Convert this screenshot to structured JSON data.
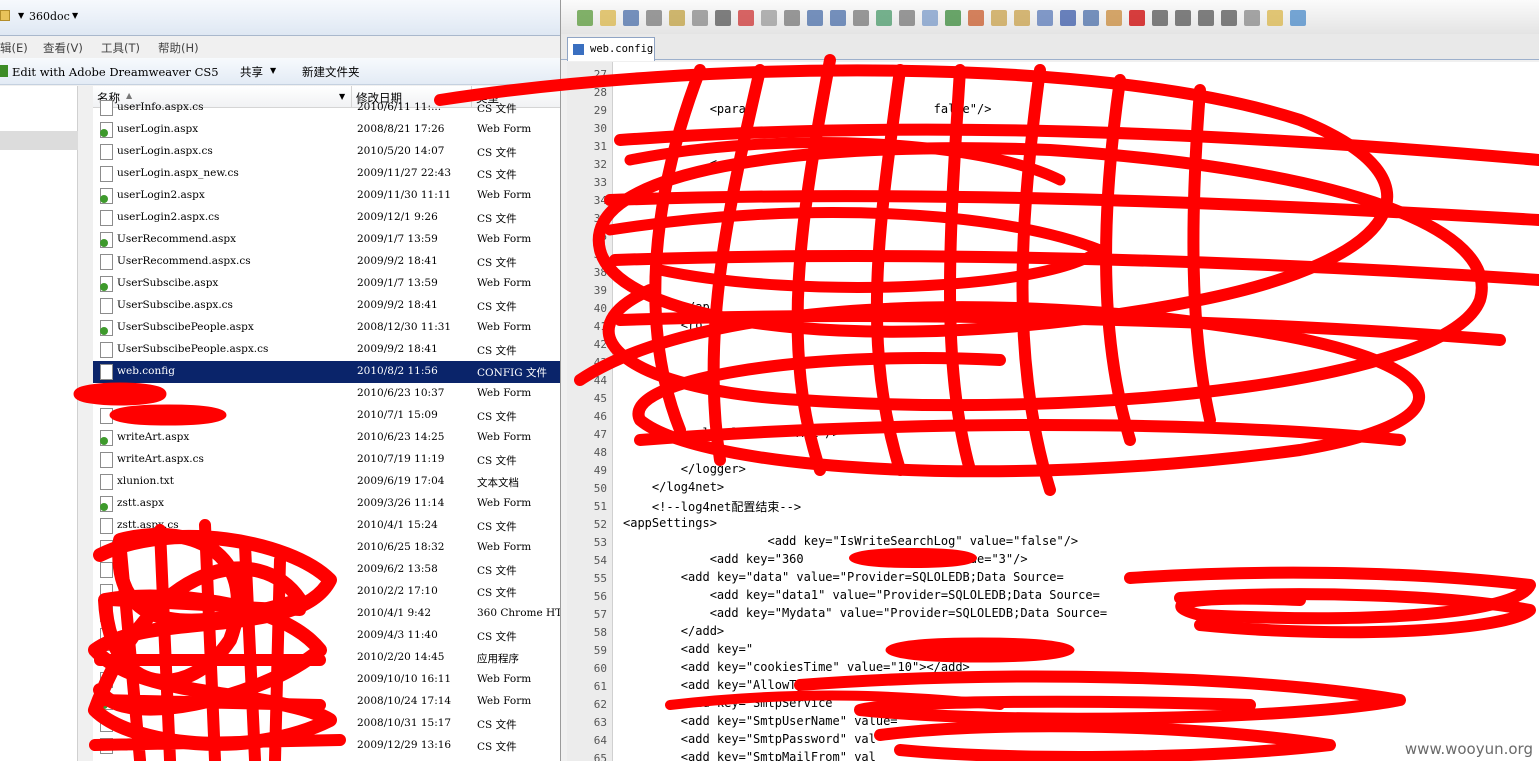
{
  "explorer": {
    "address": {
      "path": "360doc"
    },
    "menu": [
      "辑(E)",
      "查看(V)",
      "工具(T)",
      "帮助(H)"
    ],
    "commands": {
      "dreamweaver": "Edit with Adobe Dreamweaver CS5",
      "share": "共享",
      "new_folder": "新建文件夹"
    },
    "columns": {
      "name": "名称",
      "date": "修改日期",
      "type": "类型"
    },
    "files": [
      {
        "name": "userInfo.aspx.cs",
        "date": "2010/6/11 11:...",
        "type": "CS 文件",
        "icon": "cs"
      },
      {
        "name": "userLogin.aspx",
        "date": "2008/8/21 17:26",
        "type": "Web Form",
        "icon": "aspx"
      },
      {
        "name": "userLogin.aspx.cs",
        "date": "2010/5/20 14:07",
        "type": "CS 文件",
        "icon": "cs"
      },
      {
        "name": "userLogin.aspx_new.cs",
        "date": "2009/11/27 22:43",
        "type": "CS 文件",
        "icon": "cs"
      },
      {
        "name": "userLogin2.aspx",
        "date": "2009/11/30 11:11",
        "type": "Web Form",
        "icon": "aspx"
      },
      {
        "name": "userLogin2.aspx.cs",
        "date": "2009/12/1 9:26",
        "type": "CS 文件",
        "icon": "cs"
      },
      {
        "name": "UserRecommend.aspx",
        "date": "2009/1/7 13:59",
        "type": "Web Form",
        "icon": "aspx"
      },
      {
        "name": "UserRecommend.aspx.cs",
        "date": "2009/9/2 18:41",
        "type": "CS 文件",
        "icon": "cs"
      },
      {
        "name": "UserSubscibe.aspx",
        "date": "2009/1/7 13:59",
        "type": "Web Form",
        "icon": "aspx"
      },
      {
        "name": "UserSubscibe.aspx.cs",
        "date": "2009/9/2 18:41",
        "type": "CS 文件",
        "icon": "cs"
      },
      {
        "name": "UserSubscibePeople.aspx",
        "date": "2008/12/30 11:31",
        "type": "Web Form",
        "icon": "aspx"
      },
      {
        "name": "UserSubscibePeople.aspx.cs",
        "date": "2009/9/2 18:41",
        "type": "CS 文件",
        "icon": "cs"
      },
      {
        "name": "web.config",
        "date": "2010/8/2 11:56",
        "type": "CONFIG 文件",
        "icon": "cfg"
      },
      {
        "name": "",
        "date": "2010/6/23 10:37",
        "type": "Web Form",
        "icon": "aspx"
      },
      {
        "name": "",
        "date": "2010/7/1 15:09",
        "type": "CS 文件",
        "icon": "cs"
      },
      {
        "name": "writeArt.aspx",
        "date": "2010/6/23 14:25",
        "type": "Web Form",
        "icon": "aspx"
      },
      {
        "name": "writeArt.aspx.cs",
        "date": "2010/7/19 11:19",
        "type": "CS 文件",
        "icon": "cs"
      },
      {
        "name": "xlunion.txt",
        "date": "2009/6/19 17:04",
        "type": "文本文档",
        "icon": "txt"
      },
      {
        "name": "zstt.aspx",
        "date": "2009/3/26 11:14",
        "type": "Web Form",
        "icon": "aspx"
      },
      {
        "name": "zstt.aspx.cs",
        "date": "2010/4/1 15:24",
        "type": "CS 文件",
        "icon": "cs"
      },
      {
        "name": "",
        "date": "2010/6/25 18:32",
        "type": "Web Form",
        "icon": "aspx"
      },
      {
        "name": "",
        "date": "2009/6/2 13:58",
        "type": "CS 文件",
        "icon": "cs"
      },
      {
        "name": "",
        "date": "2010/2/2 17:10",
        "type": "CS 文件",
        "icon": "cs"
      },
      {
        "name": "",
        "date": "2010/4/1 9:42",
        "type": "360 Chrome HT",
        "icon": "cs"
      },
      {
        "name": "",
        "date": "2009/4/3 11:40",
        "type": "CS 文件",
        "icon": "cs"
      },
      {
        "name": "",
        "date": "2010/2/20 14:45",
        "type": "应用程序",
        "icon": "cs"
      },
      {
        "name": "",
        "date": "2009/10/10 16:11",
        "type": "Web Form",
        "icon": "aspx"
      },
      {
        "name": "",
        "date": "2008/10/24 17:14",
        "type": "Web Form",
        "icon": "aspx"
      },
      {
        "name": "",
        "date": "2008/10/31 15:17",
        "type": "CS 文件",
        "icon": "cs"
      },
      {
        "name": "",
        "date": "2009/12/29 13:16",
        "type": "CS 文件",
        "icon": "cs"
      }
    ],
    "selected_index": 12
  },
  "editor": {
    "tab": "web.config",
    "lines": [
      {
        "n": "27",
        "t": ""
      },
      {
        "n": "28",
        "t": ""
      },
      {
        "n": "29",
        "t": "            <param                         false\"/>"
      },
      {
        "n": "30",
        "t": ""
      },
      {
        "n": "31",
        "t": ""
      },
      {
        "n": "32",
        "t": "            <"
      },
      {
        "n": "33",
        "t": ""
      },
      {
        "n": "34",
        "t": ""
      },
      {
        "n": "35",
        "t": ""
      },
      {
        "n": "36",
        "t": ""
      },
      {
        "n": "37",
        "t": ""
      },
      {
        "n": "38",
        "t": ""
      },
      {
        "n": "39",
        "t": ""
      },
      {
        "n": "40",
        "t": "        </ap"
      },
      {
        "n": "41",
        "t": "        <ro"
      },
      {
        "n": "42",
        "t": ""
      },
      {
        "n": "43",
        "t": ""
      },
      {
        "n": "44",
        "t": ""
      },
      {
        "n": "45",
        "t": ""
      },
      {
        "n": "46",
        "t": ""
      },
      {
        "n": "47",
        "t": "          <level value=\"ALL\"/>"
      },
      {
        "n": "48",
        "t": ""
      },
      {
        "n": "49",
        "t": "        </logger>"
      },
      {
        "n": "50",
        "t": "    </log4net>"
      },
      {
        "n": "51",
        "t": "    <!--log4net配置结束-->"
      },
      {
        "n": "52",
        "t": "<appSettings>"
      },
      {
        "n": "53",
        "t": "                    <add key=\"IsWriteSearchLog\" value=\"false\"/>"
      },
      {
        "n": "54",
        "t": "            <add key=\"360            verNum\" value=\"3\"/>"
      },
      {
        "n": "55",
        "t": "        <add key=\"data\" value=\"Provider=SQLOLEDB;Data Source="
      },
      {
        "n": "56",
        "t": "            <add key=\"data1\" value=\"Provider=SQLOLEDB;Data Source="
      },
      {
        "n": "57",
        "t": "            <add key=\"Mydata\" value=\"Provider=SQLOLEDB;Data Source="
      },
      {
        "n": "58",
        "t": "        </add>"
      },
      {
        "n": "59",
        "t": "        <add key=\"                              \"/>"
      },
      {
        "n": "60",
        "t": "        <add key=\"cookiesTime\" value=\"10\"></add>"
      },
      {
        "n": "61",
        "t": "        <add key=\"AllowTy"
      },
      {
        "n": "62",
        "t": "        <add key=\"SmtpService"
      },
      {
        "n": "63",
        "t": "        <add key=\"SmtpUserName\" value="
      },
      {
        "n": "64",
        "t": "        <add key=\"SmtpPassword\" val"
      },
      {
        "n": "65",
        "t": "        <add key=\"SmtpMailFrom\" val                              ></add>"
      }
    ]
  },
  "watermark": "www.wooyun.org",
  "colors": {
    "selection": "#0a246a",
    "scribble": "#ff0000",
    "aspx_icon": "#3e9a2c"
  }
}
